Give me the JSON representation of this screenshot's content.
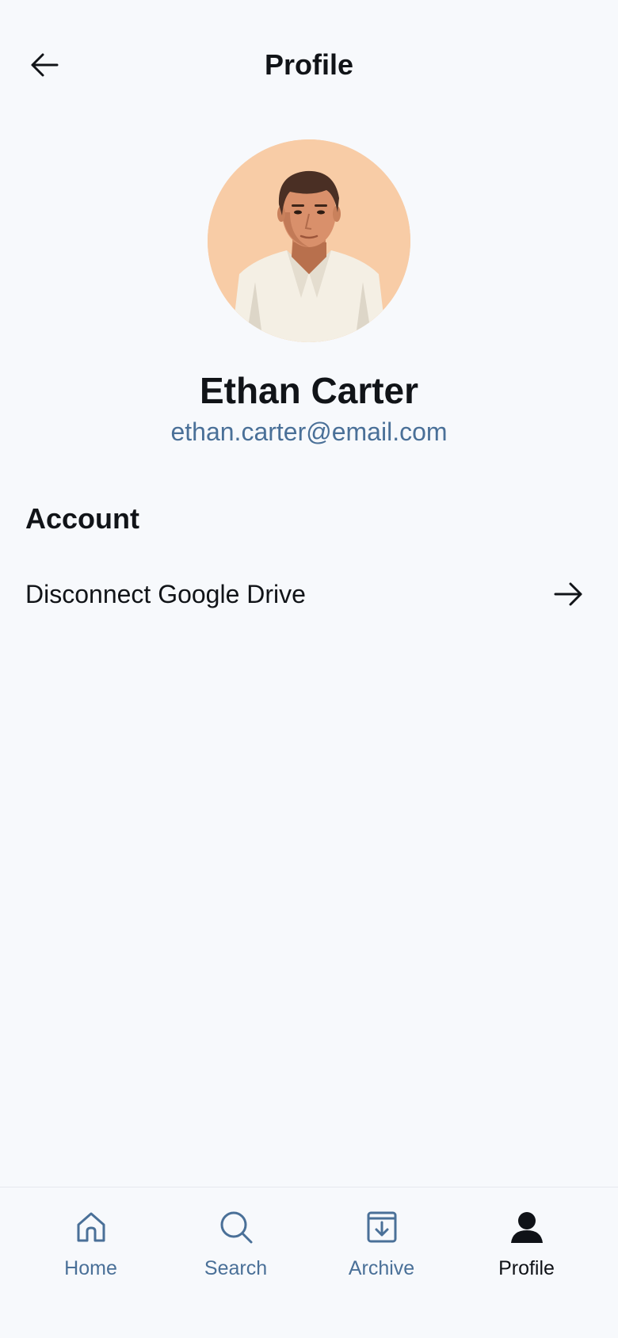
{
  "header": {
    "title": "Profile",
    "back_icon": "arrow-left-icon"
  },
  "profile": {
    "name": "Ethan Carter",
    "email": "ethan.carter@email.com",
    "avatar_icon": "user-portrait-avatar"
  },
  "account": {
    "section_title": "Account",
    "items": [
      {
        "label": "Disconnect Google Drive",
        "icon": "arrow-right-icon"
      }
    ]
  },
  "bottom_nav": {
    "items": [
      {
        "label": "Home",
        "icon": "home-icon",
        "active": false
      },
      {
        "label": "Search",
        "icon": "search-icon",
        "active": false
      },
      {
        "label": "Archive",
        "icon": "archive-icon",
        "active": false
      },
      {
        "label": "Profile",
        "icon": "person-icon",
        "active": true
      }
    ]
  },
  "colors": {
    "background": "#f7f9fc",
    "text_primary": "#111418",
    "text_secondary": "#4a7098",
    "avatar_bg": "#f8cca6"
  }
}
